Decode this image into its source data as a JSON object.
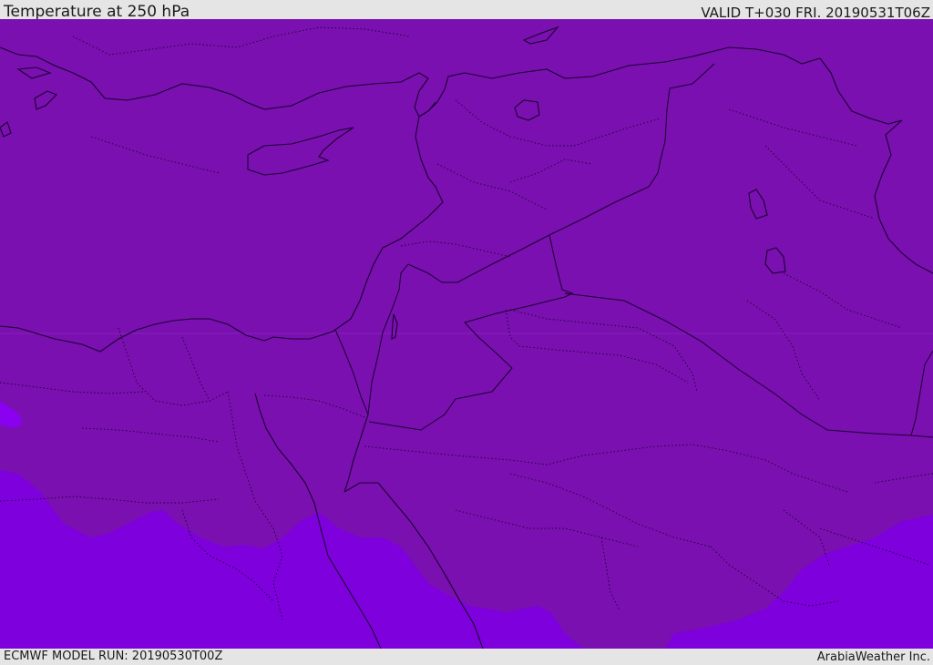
{
  "header": {
    "title": "Temperature at 250 hPa",
    "valid": "VALID T+030 FRI. 20190531T06Z"
  },
  "footer": {
    "model_run": "ECMWF MODEL RUN: 20190530T00Z",
    "credit": "ArabiaWeather Inc."
  },
  "map": {
    "field_colors": {
      "base": "#7a10b0",
      "warmer_zone": "#7e00dc",
      "hot_spot": "#8a00f0"
    },
    "line_color": "#1a0030"
  }
}
